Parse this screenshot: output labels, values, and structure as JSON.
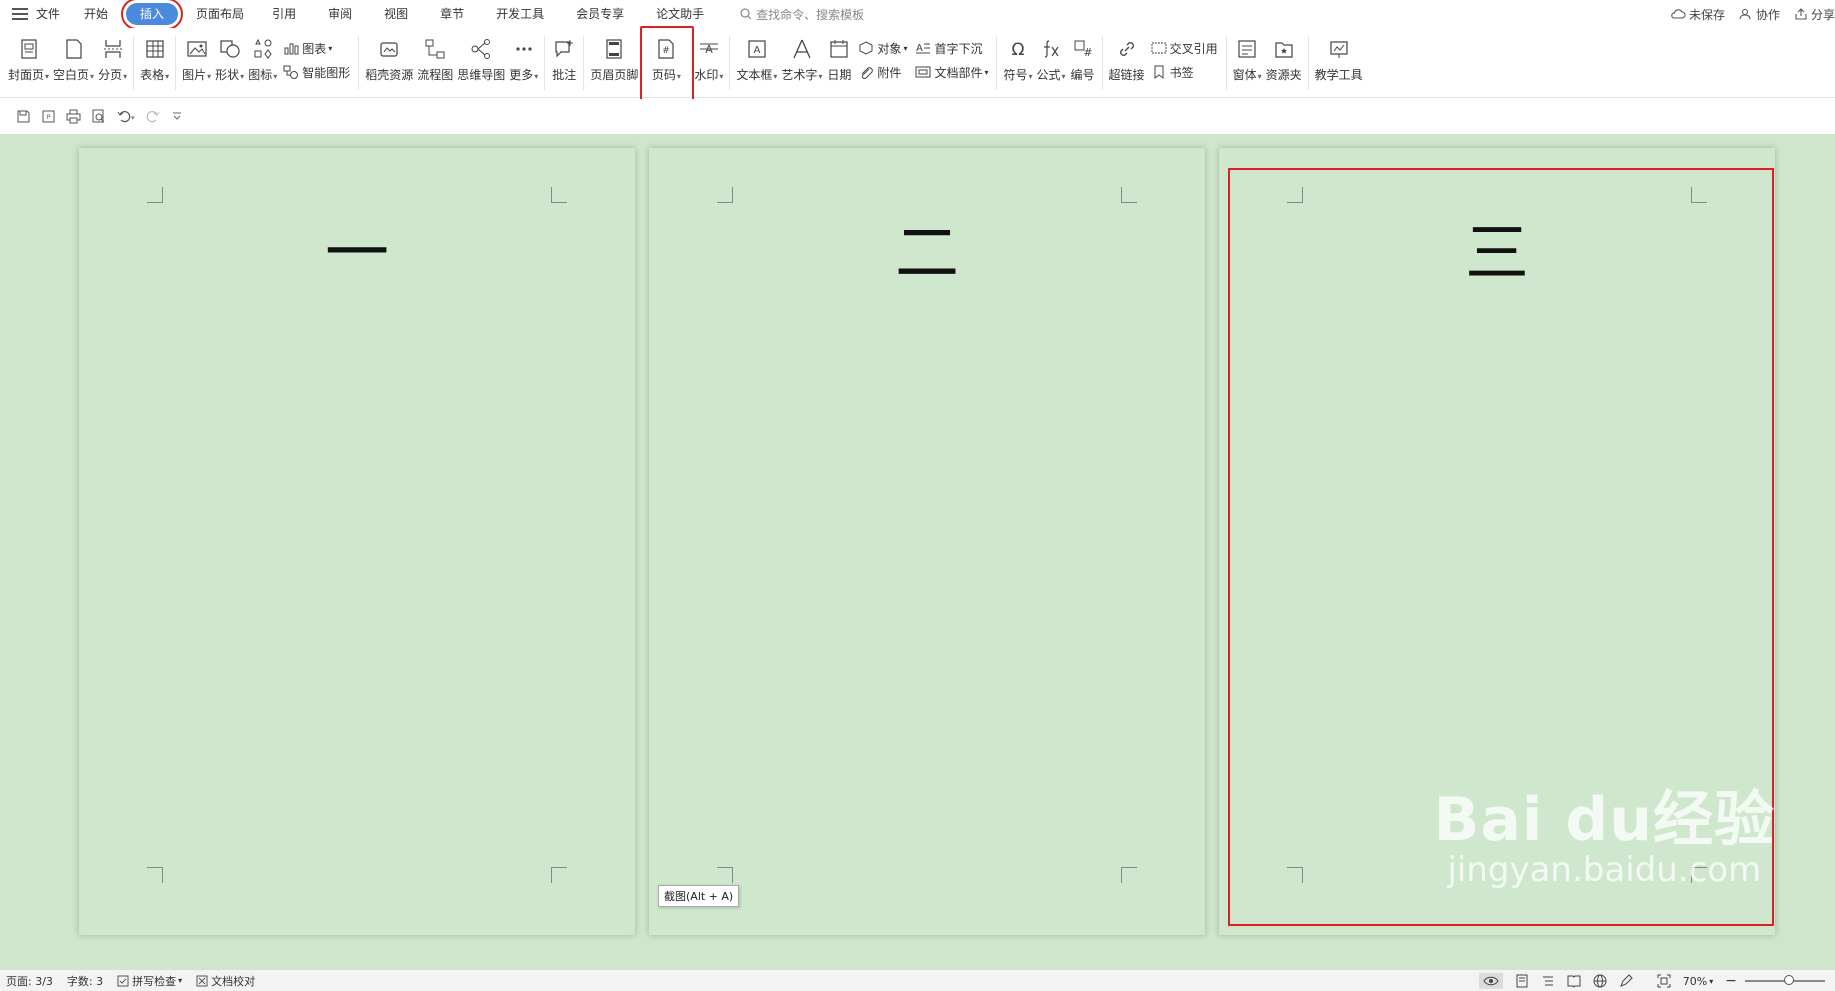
{
  "menu": {
    "items": [
      "文件",
      "开始",
      "插入",
      "页面布局",
      "引用",
      "审阅",
      "视图",
      "章节",
      "开发工具",
      "会员专享",
      "论文助手"
    ],
    "active": "插入",
    "search_placeholder": "查找命令、搜索模板",
    "right": {
      "unsaved": "未保存",
      "collab": "协作",
      "share": "分享"
    }
  },
  "ribbon": {
    "cover": "封面页",
    "blank": "空白页",
    "pagebreak": "分页",
    "table": "表格",
    "picture": "图片",
    "shape": "形状",
    "icon": "图标",
    "chart": "图表",
    "smartart": "智能图形",
    "resources": "稻壳资源",
    "flowchart": "流程图",
    "mindmap": "思维导图",
    "more": "更多",
    "comment": "批注",
    "headerfooter": "页眉页脚",
    "pagenum": "页码",
    "watermark": "水印",
    "textbox": "文本框",
    "wordart": "艺术字",
    "date": "日期",
    "object": "对象",
    "attachment": "附件",
    "dropcap": "首字下沉",
    "docparts": "文档部件",
    "symbol": "符号",
    "formula": "公式",
    "numbering": "编号",
    "hyperlink": "超链接",
    "crossref": "交叉引用",
    "bookmark": "书签",
    "window": "窗体",
    "resfolder": "资源夹",
    "teaching": "教学工具"
  },
  "pages": [
    {
      "char": "一"
    },
    {
      "char": "二"
    },
    {
      "char": "三"
    }
  ],
  "tooltip": "截图(Alt + A)",
  "watermark": {
    "logo": "Bai du经验",
    "url": "jingyan.baidu.com"
  },
  "status": {
    "page": "页面: 3/3",
    "words": "字数: 3",
    "spell": "拼写检查",
    "proof": "文档校对",
    "zoom": "70%",
    "zoom_level": 0.55
  },
  "colors": {
    "accent": "#4a89dc",
    "highlight": "#e02020",
    "page_bg": "#cfe7cd"
  }
}
